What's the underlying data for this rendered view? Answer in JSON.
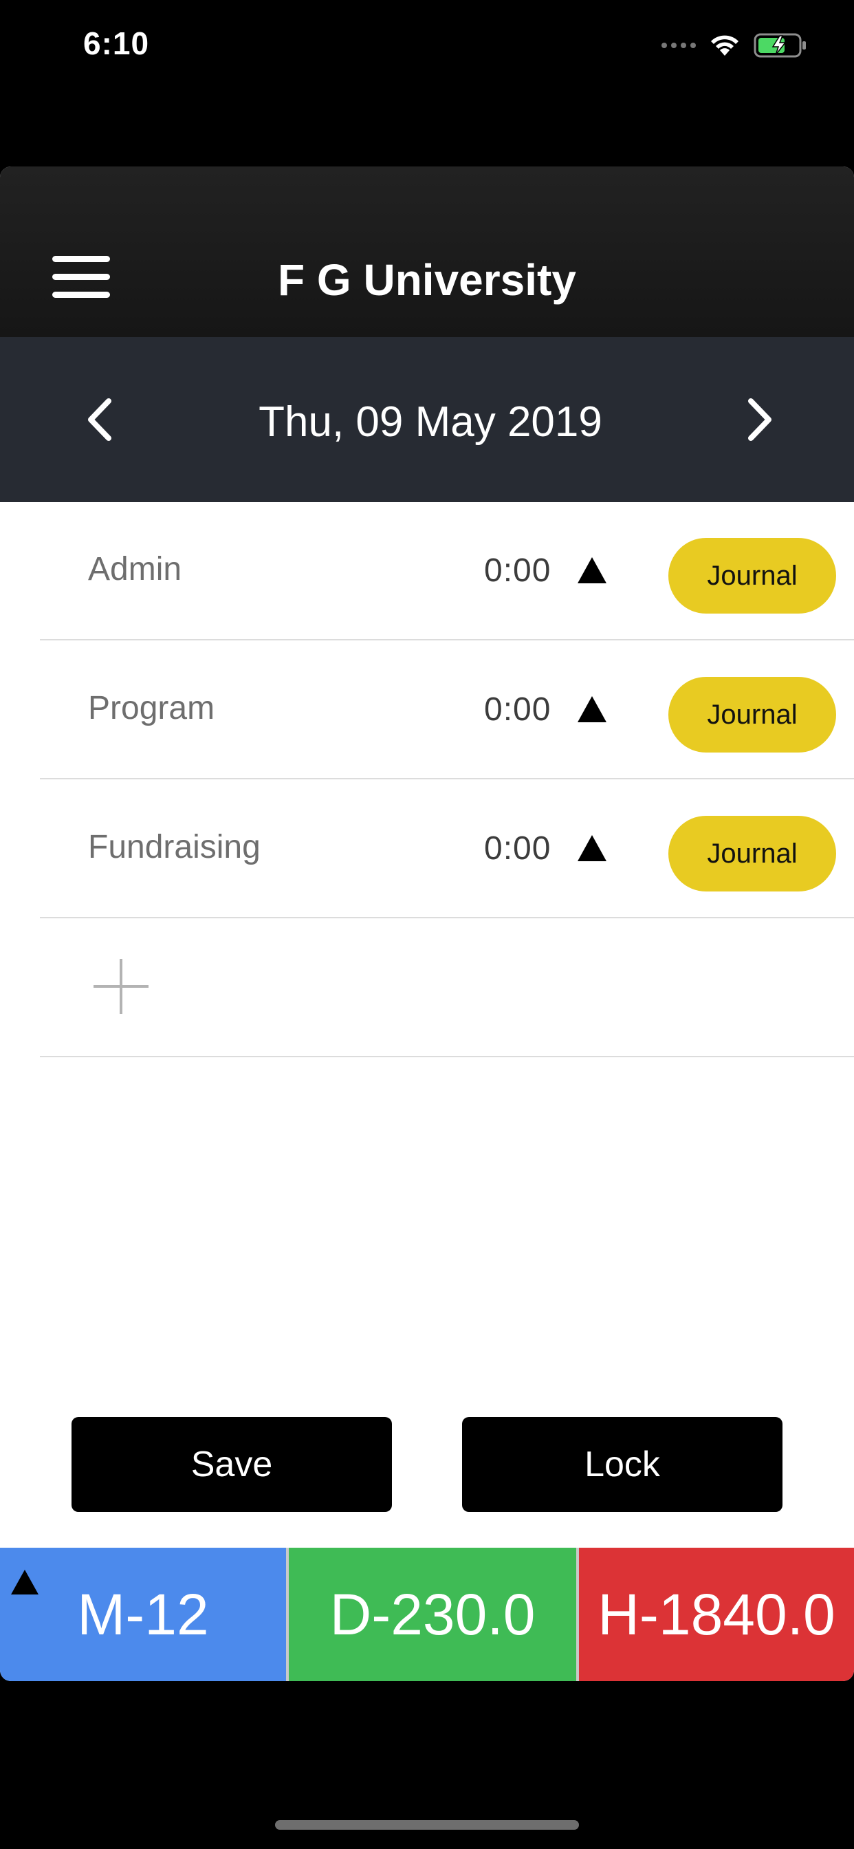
{
  "status_bar": {
    "time": "6:10"
  },
  "app": {
    "title": "F G University"
  },
  "date_nav": {
    "date": "Thu, 09 May 2019"
  },
  "rows": [
    {
      "label": "Admin",
      "value": "0:00",
      "button": "Journal"
    },
    {
      "label": "Program",
      "value": "0:00",
      "button": "Journal"
    },
    {
      "label": "Fundraising",
      "value": "0:00",
      "button": "Journal"
    }
  ],
  "actions": {
    "save_label": "Save",
    "lock_label": "Lock"
  },
  "stats": {
    "m_label": "M-12",
    "d_label": "D-230.0",
    "h_label": "H-1840.0"
  },
  "colors": {
    "accent_yellow": "#e8cb22",
    "stat_blue": "#4c8aec",
    "stat_green": "#3fbb55",
    "stat_red": "#dc3336",
    "battery_green": "#4cd964"
  }
}
